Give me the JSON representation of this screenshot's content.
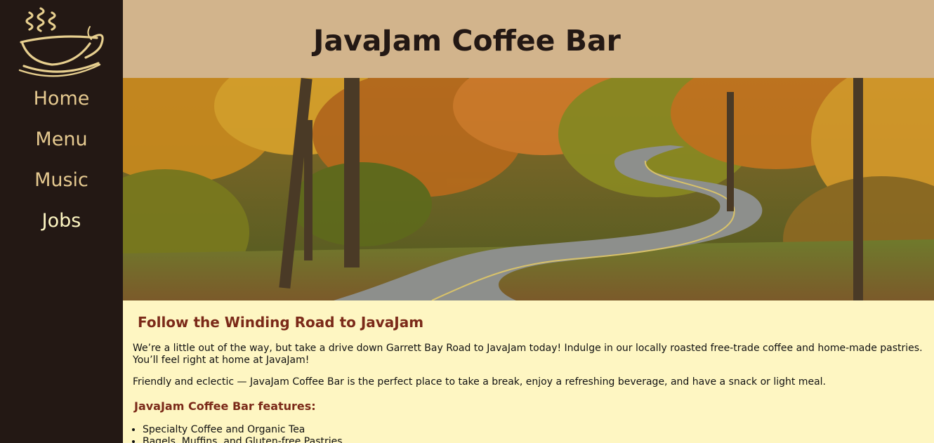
{
  "site": {
    "title": "JavaJam Coffee Bar"
  },
  "nav": {
    "items": [
      {
        "label": "Home"
      },
      {
        "label": "Menu"
      },
      {
        "label": "Music"
      },
      {
        "label": "Jobs"
      }
    ],
    "current": "Jobs"
  },
  "logo": {
    "icon": "coffee-cup-logo"
  },
  "hero": {
    "image": "winding-road-autumn-forest"
  },
  "main": {
    "heading": "Follow the Winding Road to JavaJam",
    "paragraph1": "We’re a little out of the way, but take a drive down Garrett Bay Road to JavaJam today! Indulge in our locally roasted free-trade coffee and home-made pastries. You’ll feel right at home at JavaJam!",
    "paragraph2": "Friendly and eclectic — JavaJam Coffee Bar is the perfect place to take a break, enjoy a refreshing beverage, and have a snack or light meal.",
    "features_heading": "JavaJam Coffee Bar features:",
    "features": [
      "Specialty Coffee and Organic Tea",
      "Bagels, Muffins, and Gluten-free Pastries"
    ]
  },
  "colors": {
    "sidebar_bg": "#231814",
    "header_bg": "#d2b48c",
    "content_bg": "#fef6c2",
    "nav_text": "#e5c990",
    "heading_text": "#7b2a19"
  }
}
